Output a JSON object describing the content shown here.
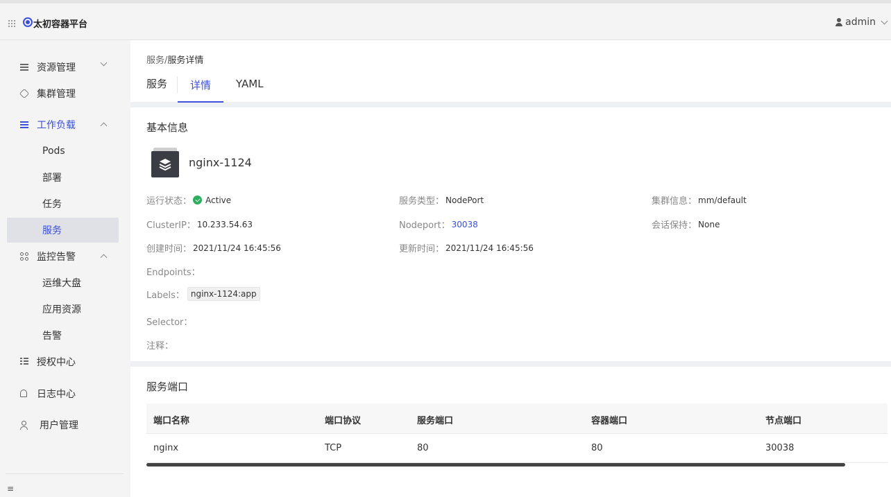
{
  "app": {
    "title": "太初容器平台",
    "user": "admin"
  },
  "sidebar": {
    "items": [
      {
        "label": "资源管理",
        "icon": "sliders-icon"
      },
      {
        "label": "集群管理",
        "icon": "cluster-icon"
      },
      {
        "label": "工作负载",
        "icon": "sliders-icon"
      },
      {
        "label": "Pods"
      },
      {
        "label": "部署"
      },
      {
        "label": "任务"
      },
      {
        "label": "服务"
      },
      {
        "label": "监控告警",
        "icon": "grid-icon"
      },
      {
        "label": "运维大盘"
      },
      {
        "label": "应用资源"
      },
      {
        "label": "告警"
      },
      {
        "label": "授权中心",
        "icon": "list-icon"
      },
      {
        "label": "日志中心",
        "icon": "bell-icon"
      },
      {
        "label": "用户管理",
        "icon": "person-icon"
      }
    ],
    "collapse_icon": "≡"
  },
  "header": {
    "breadcrumb": {
      "parent": "服务",
      "separator": "/",
      "current": "服务详情"
    },
    "tabs": {
      "main": "服务",
      "detail": "详情",
      "yaml": "YAML"
    }
  },
  "basic": {
    "title": "基本信息",
    "name": "nginx-1124",
    "fields": {
      "status_label": "运行状态：",
      "status_value": "Active",
      "service_type_label": "服务类型：",
      "service_type_value": "NodePort",
      "cluster_info_label": "集群信息：",
      "cluster_info_value": "mm/default",
      "cluster_ip_label": "ClusterIP：",
      "cluster_ip_value": "10.233.54.63",
      "nodeport_label": "Nodeport：",
      "nodeport_value": "30038",
      "session_label": "会话保持：",
      "session_value": "None",
      "created_label": "创建时间：",
      "created_value": "2021/11/24 16:45:56",
      "updated_label": "更新时间：",
      "updated_value": "2021/11/24 16:45:56",
      "endpoints_label": "Endpoints：",
      "labels_label": "Labels：",
      "labels_value": "nginx-1124:app",
      "selector_label": "Selector：",
      "annotations_label": "注释："
    }
  },
  "ports": {
    "title": "服务端口",
    "columns": [
      "端口名称",
      "端口协议",
      "服务端口",
      "容器端口",
      "节点端口"
    ],
    "rows": [
      [
        "nginx",
        "TCP",
        "80",
        "80",
        "30038"
      ]
    ]
  },
  "colors": {
    "accent": "#3b4fd8",
    "success": "#2dae5c"
  }
}
